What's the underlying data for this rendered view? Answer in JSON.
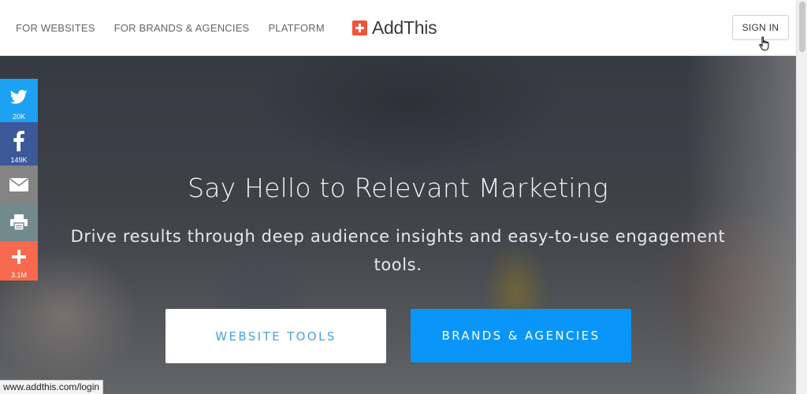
{
  "header": {
    "nav": [
      "FOR WEBSITES",
      "FOR BRANDS & AGENCIES",
      "PLATFORM"
    ],
    "logo_text": "AddThis",
    "signin_label": "SIGN IN"
  },
  "hero": {
    "title": "Say Hello to Relevant Marketing",
    "subtitle": "Drive results through deep audience insights and easy-to-use engagement tools.",
    "primary_button": "WEBSITE TOOLS",
    "secondary_button": "BRANDS & AGENCIES"
  },
  "share_bar": {
    "twitter_count": "20K",
    "facebook_count": "149K",
    "more_count": "3.1M"
  },
  "status_bar": {
    "url": "www.addthis.com/login"
  },
  "colors": {
    "brand_orange": "#f3543c",
    "primary_blue": "#0a96f8",
    "twitter": "#1da1f2",
    "facebook": "#3b5998",
    "more": "#f8694d"
  }
}
